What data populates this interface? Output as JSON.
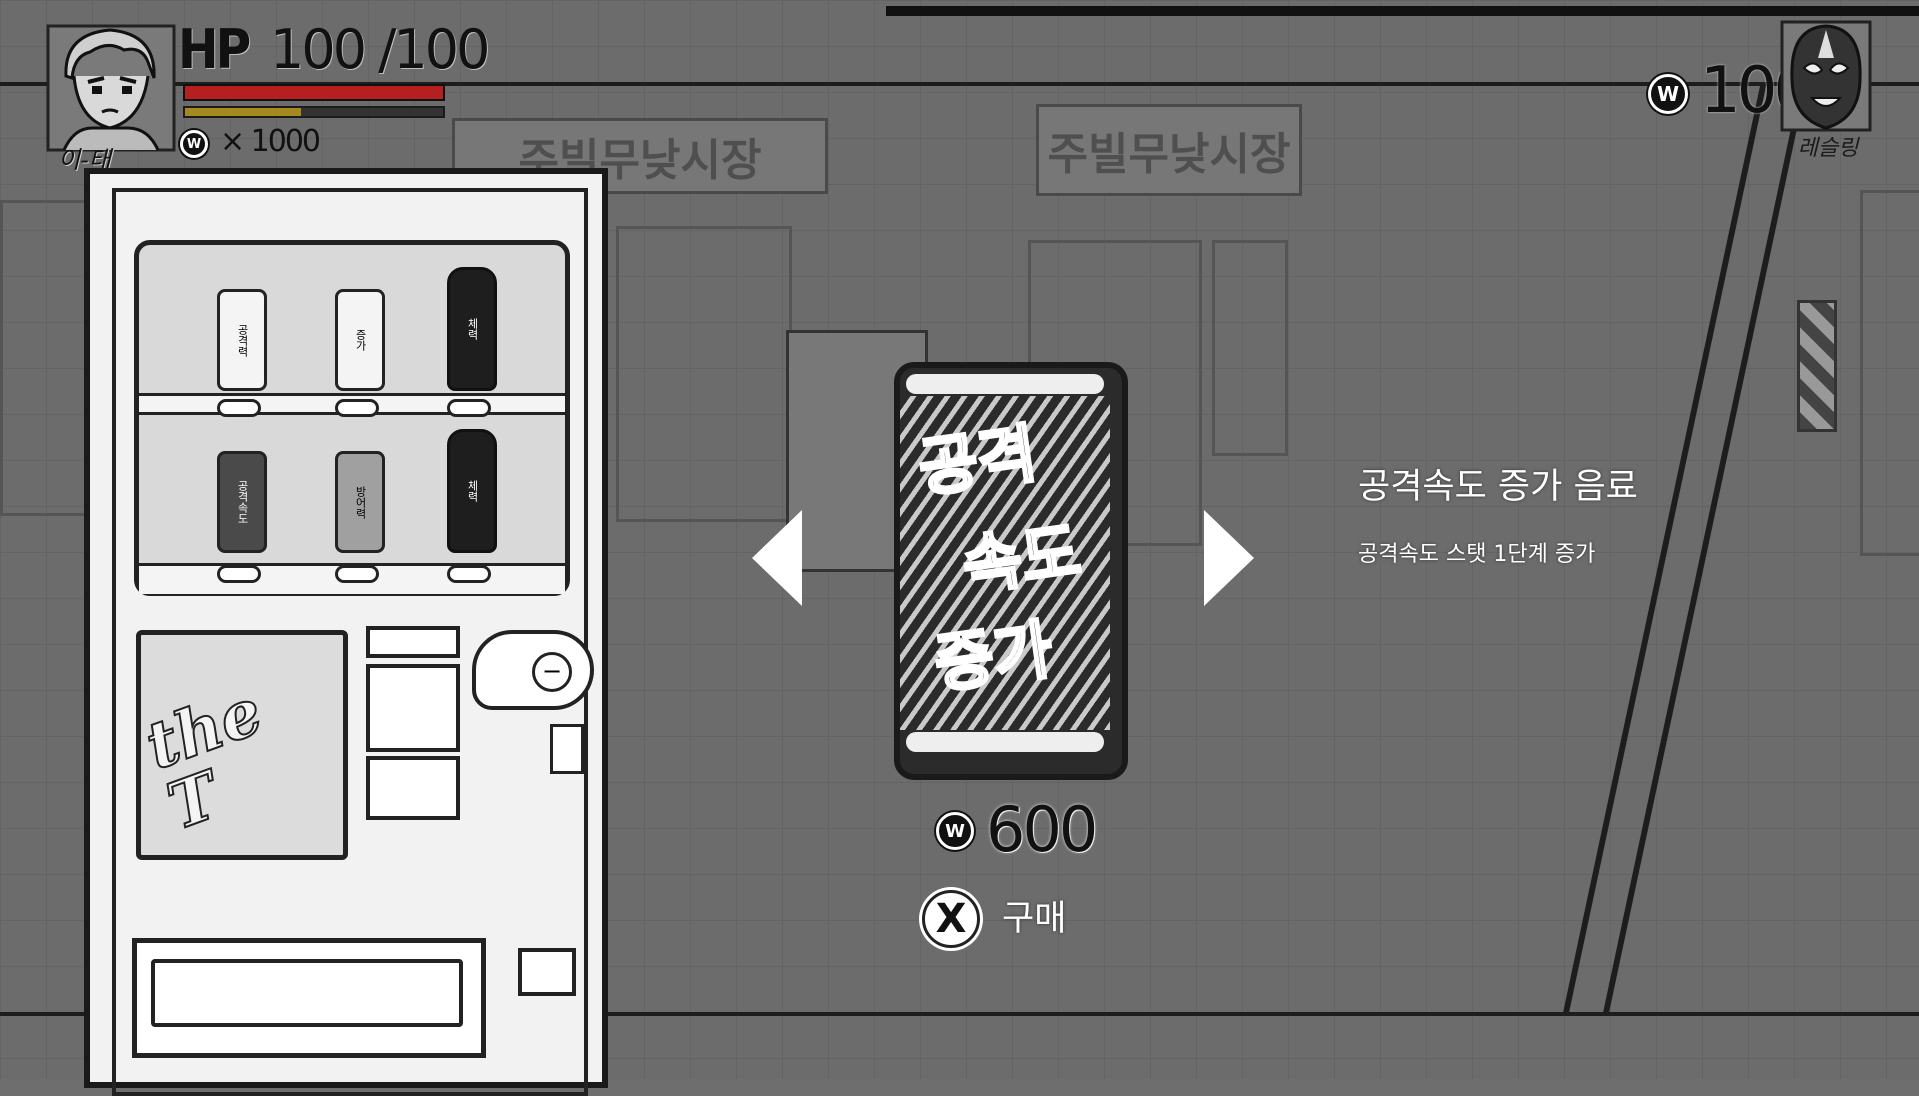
{
  "hud": {
    "character_name": "이-태",
    "hp_label": "HP",
    "hp_value": "100 /100",
    "hp": {
      "current": 100,
      "max": 100
    },
    "stamina_fraction": 0.45,
    "currency_symbol": "W",
    "lives_text": "× 1000",
    "money": "1000",
    "mask_label": "레슬링"
  },
  "background_signs": [
    "주빌무낮시장",
    "주빌무낮시장"
  ],
  "vending_machine": {
    "brand": "the T",
    "drinks_row1": [
      "공격력",
      "증가",
      "체력"
    ],
    "drinks_row2": [
      "공격속도",
      "방어력",
      "체력"
    ]
  },
  "shop": {
    "item_title": "공격속도 증가 음료",
    "item_description": "공격속도 스탯 1단계 증가",
    "can_text": [
      "공격",
      "속도",
      "증가"
    ],
    "price_currency": "W",
    "price": "600",
    "buy_button_glyph": "X",
    "buy_label": "구매"
  },
  "colors": {
    "background": "#6c6c6c",
    "hp_bar": "#b51f1f",
    "stamina_bar": "#a48a1e",
    "text_light": "#ffffff"
  },
  "icons": [
    "character-portrait-icon",
    "won-coin-icon",
    "wrestling-mask-icon",
    "arrow-left-icon",
    "arrow-right-icon",
    "x-button-icon"
  ]
}
